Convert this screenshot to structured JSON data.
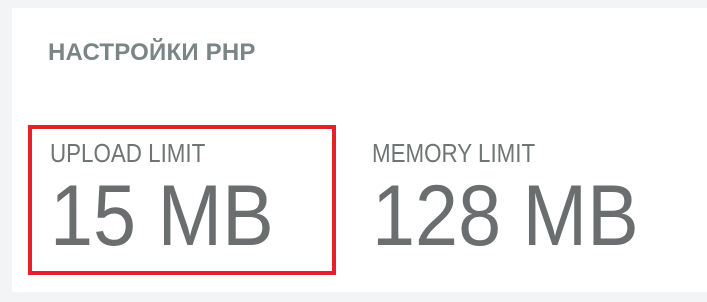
{
  "section": {
    "title": "НАСТРОЙКИ PHP"
  },
  "stats": {
    "upload_limit": {
      "label": "UPLOAD LIMIT",
      "value": "15 MB"
    },
    "memory_limit": {
      "label": "MEMORY LIMIT",
      "value": "128 MB"
    }
  },
  "colors": {
    "highlight": "#e3212b",
    "title": "#7a8585",
    "text": "#6b6e6e"
  }
}
